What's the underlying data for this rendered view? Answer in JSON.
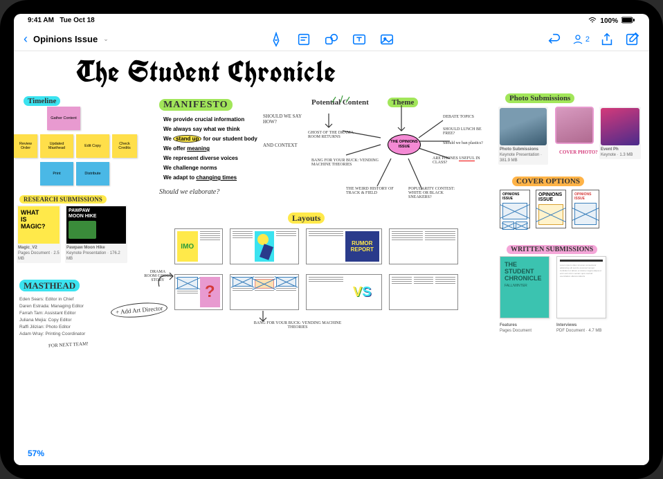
{
  "status": {
    "time": "9:41 AM",
    "date": "Tue Oct 18",
    "battery": "100%"
  },
  "toolbar": {
    "doc_title": "Opinions Issue",
    "collab_count": "2",
    "icons": {
      "pen": "pen-icon",
      "note": "sticky-note-icon",
      "shape": "shape-icon",
      "text": "text-box-icon",
      "media": "media-icon",
      "undo": "undo-icon",
      "share": "share-icon",
      "edit": "compose-icon"
    }
  },
  "canvas": {
    "title": "The Student Chronicle",
    "timeline": {
      "label": "Timeline",
      "stickies": [
        "Gather Content",
        "Review Order",
        "Updated Masthead",
        "Edit Copy",
        "Check Credits",
        "Print",
        "Distribute"
      ]
    },
    "manifesto": {
      "label": "MANIFESTO",
      "items": [
        "We provide crucial information",
        "We always say what we think",
        "We stand up for our student body",
        "We offer meaning",
        "We represent diverse voices",
        "We challenge norms",
        "We adapt to changing times"
      ],
      "annot_sayhow": "SHOULD WE SAY HOW?",
      "annot_context": "AND CONTEXT",
      "annot_elaborate": "Should we elaborate?",
      "annot_standup": "stand up",
      "annot_meaning": "meaning",
      "annot_changing": "changing times"
    },
    "mindmap": {
      "label_potential": "Potential Content",
      "label_theme": "Theme",
      "bubble": "THE OPINIONS ISSUE",
      "nodes": {
        "debate": "DEBATE TOPICS",
        "lunch": "SHOULD LUNCH BE FREE?",
        "plastics": "Should we ban plastics?",
        "phones": "ARE PHONES USEFUL IN CLASS?",
        "popularity": "POPULARITY CONTEST: WHITE OR BLACK SNEAKERS?",
        "track": "THE WEIRD HISTORY OF TRACK & FIELD",
        "vending": "BANG FOR YOUR BUCK: VENDING MACHINE THEORIES",
        "ghost": "GHOST OF THE DRAMA ROOM RETURNS"
      }
    },
    "research": {
      "label": "RESEARCH SUBMISSIONS",
      "files": [
        {
          "title": "WHAT IS MAGIC?",
          "name": "Magic_V2",
          "meta": "Pages Document · 2.5 MB"
        },
        {
          "title": "PAWPAW MOON HIKE",
          "name": "Pawpaw Moon Hike",
          "meta": "Keynote Presentation · 176.2 MB"
        }
      ]
    },
    "layouts": {
      "label": "Layouts",
      "imo": "IMO",
      "rumor": "RUMOR REPORT",
      "vs": "VS",
      "drama_annot": "DRAMA ROOM GHOST STORY",
      "vending_annot": "BANG FOR YOUR BUCK: VENDING MACHINE THEORIES"
    },
    "photo": {
      "label": "Photo Submissions",
      "cover_annot": "COVER PHOTO?",
      "files": [
        {
          "name": "Photo Submissions",
          "meta": "Keynote Presentation · 381.9 MB"
        },
        {
          "name": "Event Ph",
          "meta": "Keynote · 1.3 MB"
        }
      ]
    },
    "cover": {
      "label": "COVER OPTIONS",
      "titles": [
        "OPINIONS ISSUE",
        "OPINIONS ISSUE",
        "OPINIONS ISSUE"
      ]
    },
    "written": {
      "label": "WRITTEN SUBMISSIONS",
      "chronicle_title": "THE STUDENT CHRONICLE",
      "chronicle_sub": "FALL/WINTER",
      "files": [
        {
          "name": "Features",
          "meta": "Pages Document"
        },
        {
          "name": "Interviews",
          "meta": "PDF Document · 4.7 MB"
        }
      ]
    },
    "masthead": {
      "label": "MASTHEAD",
      "items": [
        "Eden Sears: Editor in Chief",
        "Daren Estrada: Managing Editor",
        "Farrah Tam: Assistant Editor",
        "Juliana Mejia: Copy Editor",
        "Raffi Jilizian: Photo Editor",
        "Adam Wray: Printing Coordinator"
      ],
      "add_art": "+ Add Art Director",
      "next_team": "FOR NEXT TEAM!"
    },
    "zoom": "57%"
  }
}
